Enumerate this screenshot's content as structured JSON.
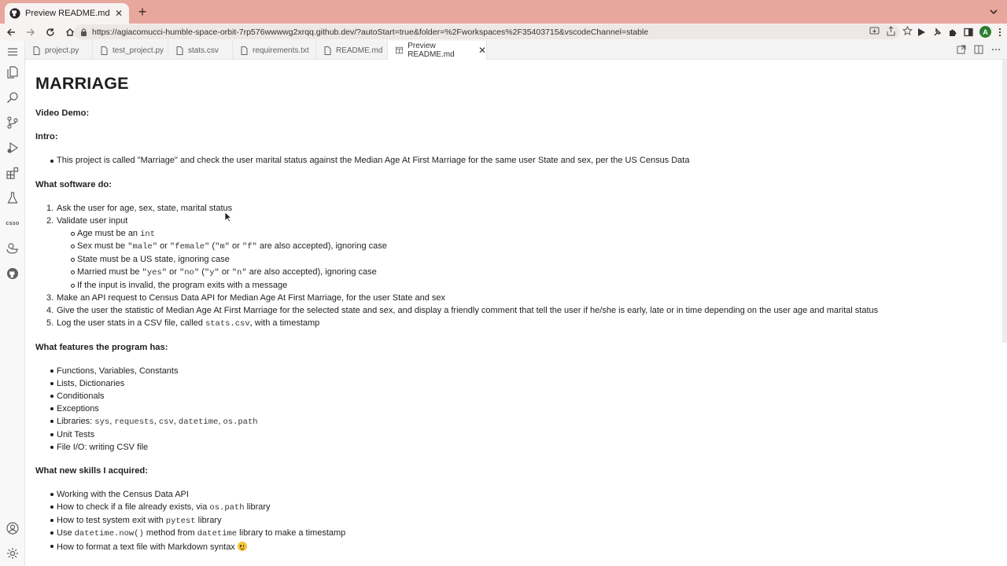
{
  "browser": {
    "tab_title": "Preview README.md — 35403715",
    "url": "https://agiacomucci-humble-space-orbit-7rp576wwwwg2xrqq.github.dev/?autoStart=true&folder=%2Fworkspaces%2F35403715&vscodeChannel=stable",
    "avatar_letter": "A"
  },
  "editor_tabs": [
    {
      "label": "project.py"
    },
    {
      "label": "test_project.py"
    },
    {
      "label": "stats.csv"
    },
    {
      "label": "requirements.txt"
    },
    {
      "label": "README.md"
    },
    {
      "label": "Preview README.md"
    }
  ],
  "activity_bar": {
    "csso_label": "csso"
  },
  "readme": {
    "title": "MARRIAGE",
    "video_demo": "Video Demo:",
    "intro_heading": "Intro:",
    "intro_item": "This project is called \"Marriage\" and check the user marital status against the Median Age At First Marriage for the same user State and sex, per the US Census Data",
    "software_heading": "What software do:",
    "steps": {
      "s1": "Ask the user for age, sex, state, marital status",
      "s2": "Validate user input",
      "s2a_pre": "Age must be an ",
      "s2a_code": "int",
      "s2b_pre": "Sex must be ",
      "s2b_c1": "\"male\"",
      "s2b_or1": " or ",
      "s2b_c2": "\"female\"",
      "s2b_paren": " (",
      "s2b_c3": "\"m\"",
      "s2b_or2": " or ",
      "s2b_c4": "\"f\"",
      "s2b_post": " are also accepted), ignoring case",
      "s2c": "State must be a US state, ignoring case",
      "s2d_pre": "Married must be ",
      "s2d_c1": "\"yes\"",
      "s2d_or1": " or ",
      "s2d_c2": "\"no\"",
      "s2d_paren": " (",
      "s2d_c3": "\"y\"",
      "s2d_or2": " or ",
      "s2d_c4": "\"n\"",
      "s2d_post": " are also accepted), ignoring case",
      "s2e": "If the input is invalid, the program exits with a message",
      "s3": "Make an API request to Census Data API for Median Age At First Marriage, for the user State and sex",
      "s4": "Give the user the statistic of Median Age At First Marriage for the selected state and sex, and display a friendly comment that tell the user if he/she is early, late or in time depending on the user age and marital status",
      "s5_pre": "Log the user stats in a CSV file, called ",
      "s5_code": "stats.csv",
      "s5_post": ", with a timestamp"
    },
    "features_heading": "What features the program has:",
    "features": {
      "f1": "Functions, Variables, Constants",
      "f2": "Lists, Dictionaries",
      "f3": "Conditionals",
      "f4": "Exceptions",
      "f5_pre": "Libraries: ",
      "f5_c1": "sys",
      "f5_c2": "requests",
      "f5_c3": "csv",
      "f5_c4": "datetime",
      "f5_c5": "os.path",
      "f5_sep": ", ",
      "f6": "Unit Tests",
      "f7": "File I/O: writing CSV file"
    },
    "skills_heading": "What new skills I acquired:",
    "skills": {
      "k1": "Working with the Census Data API",
      "k2_pre": "How to check if a file already exists, via ",
      "k2_code": "os.path",
      "k2_post": " library",
      "k3_pre": "How to test system exit with ",
      "k3_code": "pytest",
      "k3_post": " library",
      "k4_pre": "Use ",
      "k4_code": "datetime.now()",
      "k4_mid": " method from ",
      "k4_code2": "datetime",
      "k4_post": " library to make a timestamp",
      "k5": "How to format a text file with Markdown syntax "
    },
    "numbers": [
      "1.",
      "2.",
      "3.",
      "4.",
      "5."
    ]
  },
  "colors": {
    "tabstrip": "#e8a79c",
    "avatar": "#2e7d32"
  }
}
